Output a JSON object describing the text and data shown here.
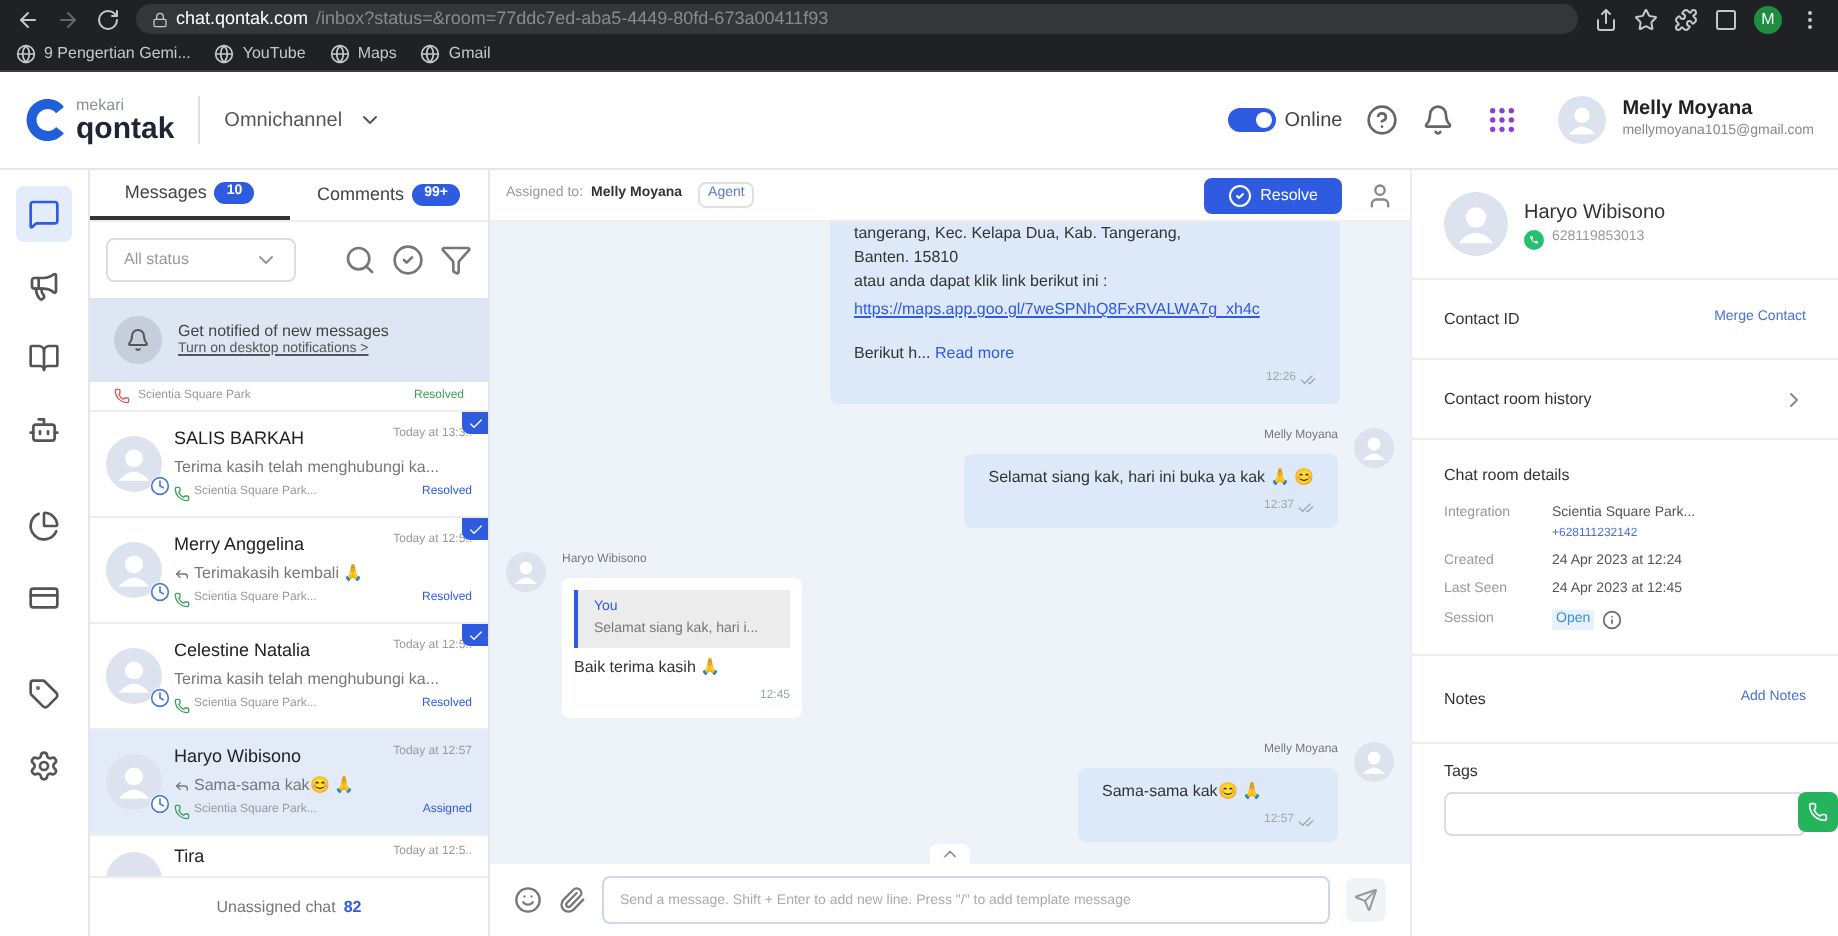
{
  "browser": {
    "url_host": "chat.qontak.com",
    "url_path": "/inbox?status=&room=77ddc7ed-aba5-4449-80fd-673a00411f93",
    "bookmarks": [
      "9 Pengertian Gemi...",
      "YouTube",
      "Maps",
      "Gmail"
    ],
    "profile_initial": "M"
  },
  "header": {
    "brand_top": "mekari",
    "brand": "qontak",
    "product": "Omnichannel",
    "online": {
      "label": "Online",
      "on": true
    },
    "user_name": "Melly Moyana",
    "user_email": "mellymoyana1015@gmail.com"
  },
  "rail": [
    {
      "selected": true
    },
    {
      "selected": false
    },
    {
      "selected": false
    },
    {
      "selected": false
    },
    {
      "selected": false
    },
    {
      "selected": false
    },
    {
      "selected": false
    },
    {
      "selected": false
    }
  ],
  "inbox": {
    "tabs": [
      {
        "label": "Messages",
        "count": "10",
        "selected": true
      },
      {
        "label": "Comments",
        "count": "99+",
        "selected": false
      }
    ],
    "filter": "All status",
    "notice": {
      "title": "Get notified of new messages",
      "link": "Turn on desktop notifications >"
    },
    "partial": {
      "channel": "Scientia Square Park",
      "status": "Resolved"
    },
    "conversations": [
      {
        "name": "SALIS BARKAH",
        "time": "Today at 13:3..",
        "preview": "Terima kasih telah menghubungi ka...",
        "reply": false,
        "channel": "Scientia Square Park...",
        "status": "Resolved",
        "selected": false,
        "checked": true
      },
      {
        "name": "Merry Anggelina",
        "time": "Today at 12:5..",
        "preview": "Terimakasih kembali 🙏",
        "reply": true,
        "channel": "Scientia Square Park...",
        "status": "Resolved",
        "selected": false,
        "checked": true
      },
      {
        "name": "Celestine Natalia",
        "time": "Today at 12:5..",
        "preview": "Terima kasih telah menghubungi ka...",
        "reply": false,
        "channel": "Scientia Square Park...",
        "status": "Resolved",
        "selected": false,
        "checked": true
      },
      {
        "name": "Haryo Wibisono",
        "time": "Today at 12:57",
        "preview": "Sama-sama kak😊 🙏",
        "reply": true,
        "channel": "Scientia Square Park...",
        "status": "Assigned",
        "selected": true,
        "checked": false
      }
    ],
    "partial_bottom": {
      "name": "Tira",
      "time": "Today at 12:5.."
    },
    "footer": {
      "label": "Unassigned chat",
      "count": "82"
    }
  },
  "chat": {
    "assigned_label": "Assigned to:",
    "assigned_name": "Melly Moyana",
    "role": "Agent",
    "resolve": "Resolve",
    "messages": [
      {
        "kind": "long",
        "lines": [
          "tangerang, Kec. Kelapa Dua, Kab. Tangerang,",
          "Banten. 15810",
          "atau anda dapat klik link berikut ini : "
        ],
        "link": "https://maps.app.goo.gl/7weSPNhQ8FxRVALWA7g_xh4c",
        "more_prefix": "Berikut h...",
        "more": "Read more",
        "time": "12:26"
      },
      {
        "kind": "out",
        "sender": "Melly Moyana",
        "text": "Selamat siang kak, hari ini buka ya kak 🙏 😊",
        "time": "12:37"
      },
      {
        "kind": "in",
        "sender": "Haryo Wibisono",
        "quote_author": "You",
        "quote": "Selamat siang kak, hari i...",
        "text": "Baik terima kasih 🙏",
        "time": "12:45"
      },
      {
        "kind": "out",
        "sender": "Melly Moyana",
        "text": "Sama-sama kak😊 🙏",
        "time": "12:57"
      }
    ],
    "input": {
      "placeholder": "Send a message. Shift + Enter to add new line. Press \"/\" to add template message"
    }
  },
  "contact": {
    "name": "Haryo Wibisono",
    "phone": "628119853013",
    "contact_id": "Contact ID",
    "merge": "Merge Contact",
    "history": "Contact room history",
    "details_title": "Chat room details",
    "details": [
      {
        "label": "Integration",
        "value": "Scientia Square Park...",
        "sub": "+628111232142",
        "kind": "text"
      },
      {
        "label": "Created",
        "value": "24 Apr 2023 at 12:24",
        "kind": "text"
      },
      {
        "label": "Last Seen",
        "value": "24 Apr 2023 at 12:45",
        "kind": "text"
      },
      {
        "label": "Session",
        "value": "Open",
        "kind": "badge"
      }
    ],
    "notes": "Notes",
    "add_notes": "Add Notes",
    "tags": "Tags"
  }
}
